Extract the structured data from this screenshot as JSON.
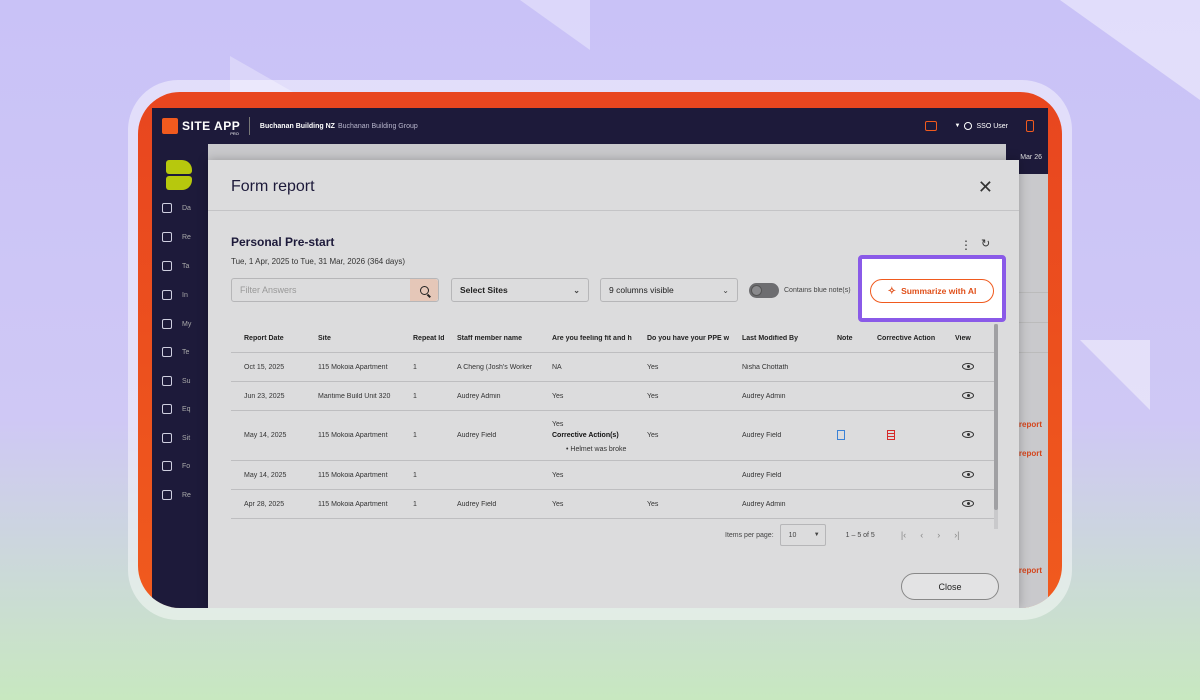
{
  "app": {
    "logo_text": "SITE APP",
    "logo_sub": "PRO",
    "company": "Buchanan Building NZ",
    "company_group": "Buchanan Building Group",
    "user": "SSO User",
    "date_partial": "Mar 26"
  },
  "sidebar": {
    "items": [
      {
        "label": "Da",
        "icon": "dashboard-icon"
      },
      {
        "label": "Re",
        "icon": "reports-icon"
      },
      {
        "label": "Ta",
        "icon": "tasks-icon"
      },
      {
        "label": "In",
        "icon": "incidents-icon"
      },
      {
        "label": "My",
        "icon": "store-icon"
      },
      {
        "label": "Te",
        "icon": "team-icon"
      },
      {
        "label": "Su",
        "icon": "truck-icon"
      },
      {
        "label": "Eq",
        "icon": "equipment-icon"
      },
      {
        "label": "Sit",
        "icon": "location-icon"
      },
      {
        "label": "Fo",
        "icon": "forms-icon"
      },
      {
        "label": "Re",
        "icon": "registers-icon"
      }
    ]
  },
  "right_panel": {
    "report_link": "report"
  },
  "modal": {
    "title": "Form report",
    "form_name": "Personal Pre-start",
    "date_range": "Tue, 1 Apr, 2025 to Tue, 31 Mar, 2026 (364 days)",
    "filter_placeholder": "Filter Answers",
    "sites_select": "Select Sites",
    "columns_select": "9 columns visible",
    "toggle_label": "Contains blue note(s)",
    "toggle_on": false,
    "summarize_button": "Summarize with AI",
    "close_button": "Close"
  },
  "table": {
    "headers": [
      "Report Date",
      "Site",
      "Repeat Id",
      "Staff member name",
      "Are you feeling fit and h",
      "Do you have your PPE w",
      "Last Modified By",
      "Note",
      "Corrective Action",
      "View"
    ],
    "rows": [
      {
        "date": "Oct 15, 2025",
        "site": "115 Mokoia Apartment",
        "repeat": "1",
        "staff": "A Cheng (Josh's Worker",
        "fit": "NA",
        "ppe": "Yes",
        "modified": "Nisha Chottath",
        "note": false,
        "ca": false
      },
      {
        "date": "Jun 23, 2025",
        "site": "Maritime Build Unit 320",
        "repeat": "1",
        "staff": "Audrey Admin",
        "fit": "Yes",
        "ppe": "Yes",
        "modified": "Audrey Admin",
        "note": false,
        "ca": false
      },
      {
        "date": "May 14, 2025",
        "site": "115 Mokoia Apartment",
        "repeat": "1",
        "staff": "Audrey Field",
        "fit": "Yes",
        "fit_ca_title": "Corrective Action(s)",
        "fit_ca_item": "Helmet was broke",
        "ppe": "Yes",
        "modified": "Audrey Field",
        "note": true,
        "ca": true
      },
      {
        "date": "May 14, 2025",
        "site": "115 Mokoia Apartment",
        "repeat": "1",
        "staff": "",
        "fit": "Yes",
        "ppe": "",
        "modified": "Audrey Field",
        "note": false,
        "ca": false
      },
      {
        "date": "Apr 28, 2025",
        "site": "115 Mokoia Apartment",
        "repeat": "1",
        "staff": "Audrey Field",
        "fit": "Yes",
        "ppe": "Yes",
        "modified": "Audrey Admin",
        "note": false,
        "ca": false
      }
    ]
  },
  "paginator": {
    "label": "Items per page:",
    "per_page": "10",
    "range": "1 – 5 of 5"
  },
  "colors": {
    "brand_orange": "#f05a1e",
    "nav_dark": "#1d1a3a",
    "highlight_purple": "#8a5ae8"
  }
}
